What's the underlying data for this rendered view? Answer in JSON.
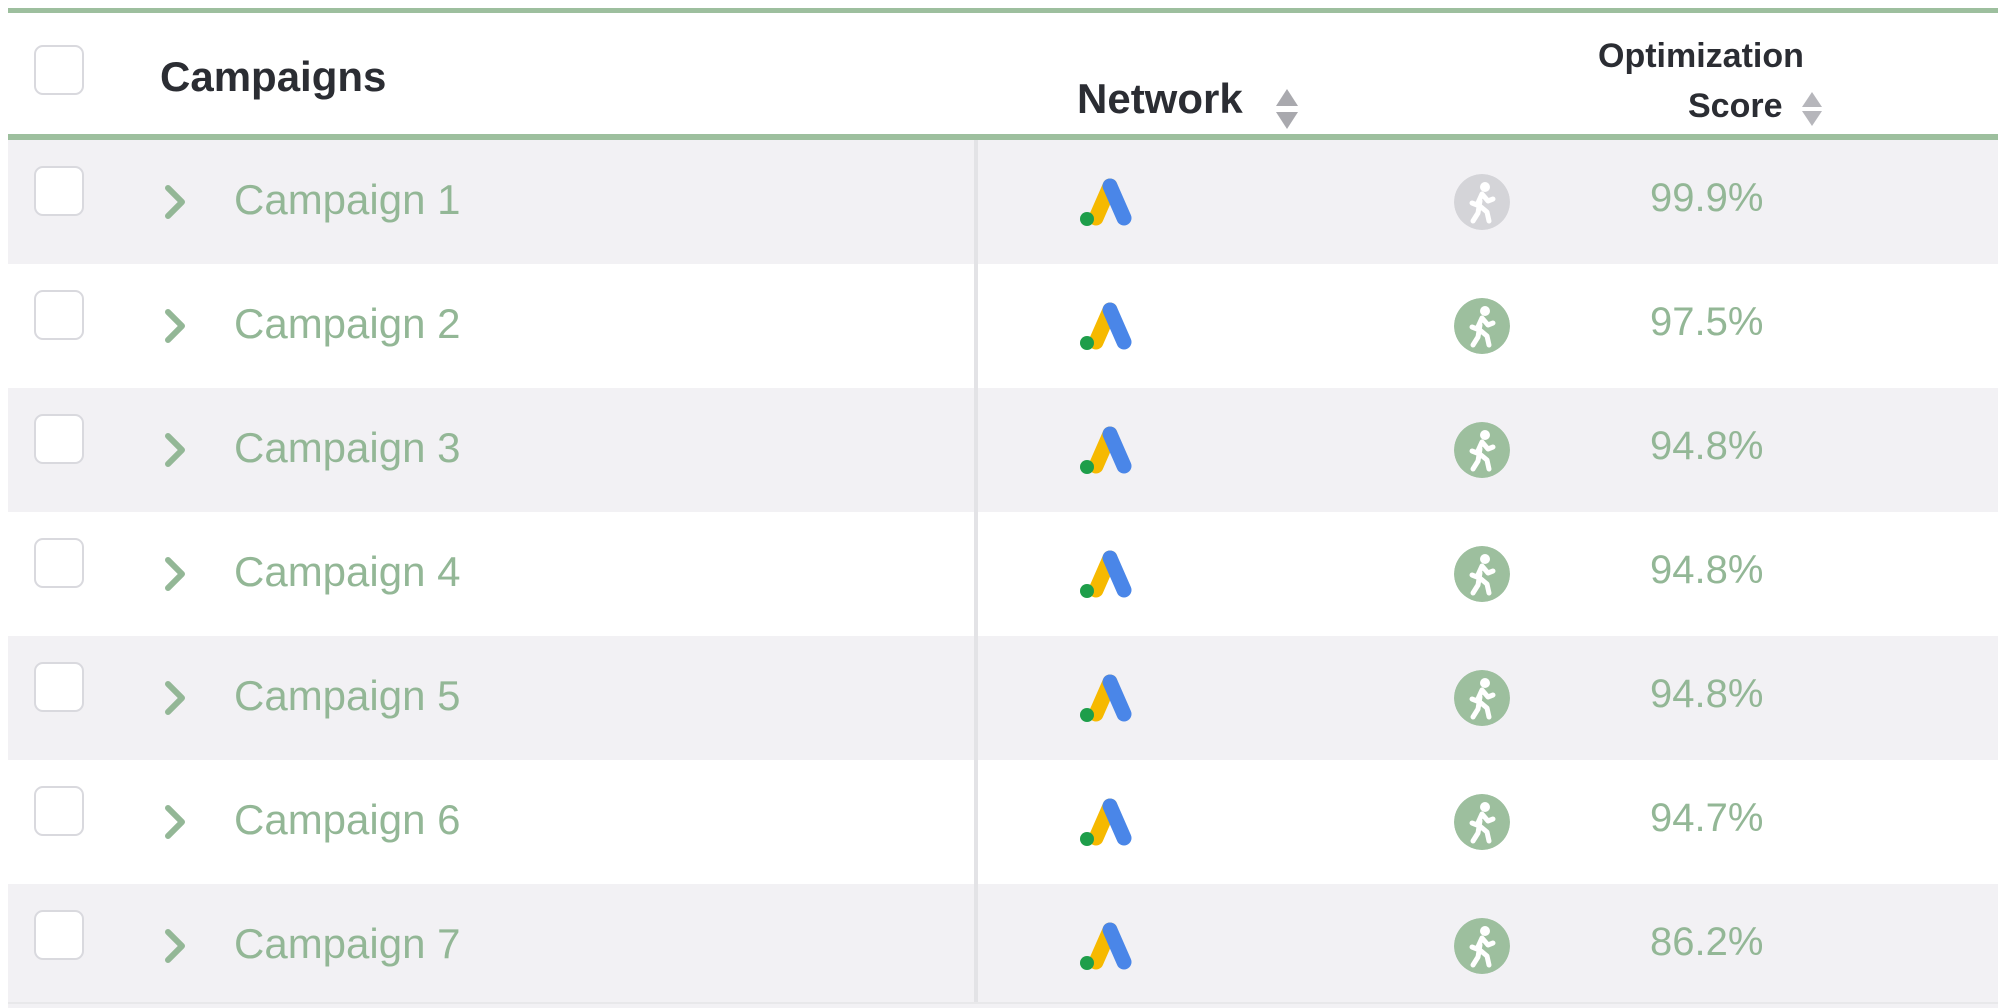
{
  "header": {
    "campaigns_label": "Campaigns",
    "network_label": "Network",
    "optimization_label_line1": "Optimization",
    "optimization_label_line2": "Score"
  },
  "icons": {
    "network_logo": "google-ads-icon",
    "status": "walking-person-icon",
    "expand": "chevron-right-icon",
    "sort": "sort-icon"
  },
  "colors": {
    "accent_green": "#9dbf9e",
    "text_green": "#93b796",
    "status_active": "#9dbf9e",
    "status_inactive": "#d4d4d8",
    "row_shade": "#f2f1f4"
  },
  "rows": [
    {
      "name": "Campaign 1",
      "score": "99.9%",
      "status": "inactive"
    },
    {
      "name": "Campaign 2",
      "score": "97.5%",
      "status": "active"
    },
    {
      "name": "Campaign 3",
      "score": "94.8%",
      "status": "active"
    },
    {
      "name": "Campaign 4",
      "score": "94.8%",
      "status": "active"
    },
    {
      "name": "Campaign 5",
      "score": "94.8%",
      "status": "active"
    },
    {
      "name": "Campaign 6",
      "score": "94.7%",
      "status": "active"
    },
    {
      "name": "Campaign 7",
      "score": "86.2%",
      "status": "active"
    }
  ]
}
